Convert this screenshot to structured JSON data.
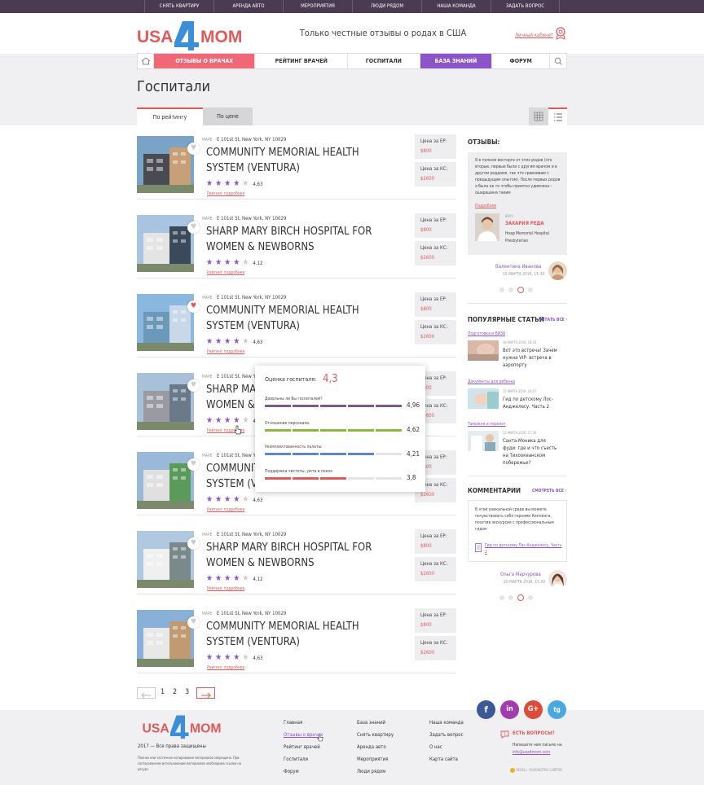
{
  "topbar": {
    "items": [
      "СНЯТЬ КВАРТИРУ",
      "АРЕНДА АВТО",
      "МЕРОПРИЯТИЯ",
      "ЛЮДИ РЯДОМ",
      "НАША КОМАНДА",
      "ЗАДАТЬ ВОПРОС"
    ]
  },
  "header": {
    "logo_left": "USA",
    "logo_mid": "4",
    "logo_right": "MOM",
    "tagline": "Только честные отзывы о родах в США",
    "cabinet": "Личный кабинет"
  },
  "nav": {
    "items": [
      "ОТЗЫВЫ О ВРАЧАХ",
      "РЕЙТИНГ ВРАЧЕЙ",
      "ГОСПИТАЛИ",
      "БАЗА ЗНАНИЙ",
      "ФОРУМ"
    ]
  },
  "page": {
    "title": "Госпитали",
    "tabs": [
      "По рейтингу",
      "По цене"
    ]
  },
  "colors": {
    "accent_red": "#e05a5a",
    "accent_purple": "#8b54c8",
    "topbar": "#4a3a52",
    "criterion_1": "#7d5a8c",
    "criterion_2": "#8ab83c",
    "criterion_3": "#5a8ac8",
    "criterion_4": "#e05a5a"
  },
  "hospitals": [
    {
      "map": "МАРЕ",
      "addr": "E 101st St, New York, NY 10029",
      "name": "COMMUNITY MEMORIAL HEALTH SYSTEM (VENTURA)",
      "rating": "4,63",
      "stars": 4,
      "more": "Рейтинг подробнее",
      "ep_label": "Цена за ЕР:",
      "ep": "$800",
      "ks_label": "Цена за КС:",
      "ks": "$2600",
      "fav": false
    },
    {
      "map": "МАРЕ",
      "addr": "E 101st St, New York, NY 10029",
      "name": "SHARP MARY BIRCH HOSPITAL FOR WOMEN & NEWBORNS",
      "rating": "4.12",
      "stars": 4,
      "more": "Рейтинг подробнее",
      "ep_label": "Цена за ЕР:",
      "ep": "$800",
      "ks_label": "Цена за КС:",
      "ks": "$2600",
      "fav": false
    },
    {
      "map": "МАРЕ",
      "addr": "E 101st St, New York, NY 10029",
      "name": "COMMUNITY MEMORIAL HEALTH SYSTEM (VENTURA)",
      "rating": "4,63",
      "stars": 4,
      "more": "Рейтинг подробнее",
      "ep_label": "Цена за ЕР:",
      "ep": "$800",
      "ks_label": "Цена за КС:",
      "ks": "$2600",
      "fav": true
    },
    {
      "map": "МАРЕ",
      "addr": "E 101st St, New York, NY 10029",
      "name": "SHARP MARY BIRCH HOSPITAL FOR WOMEN & NEWBORNS",
      "rating": "4.12",
      "stars": 4,
      "more": "Рейтинг подробнее",
      "ep_label": "Цена за ЕР:",
      "ep": "$800",
      "ks_label": "Цена за КС:",
      "ks": "$2600",
      "fav": false
    },
    {
      "map": "МАРЕ",
      "addr": "E 101st St, New York, NY 10029",
      "name": "COMMUNITY MEMORIAL HEALTH SYSTEM (VENTURA)",
      "rating": "4,63",
      "stars": 4,
      "more": "Рейтинг подробнее",
      "ep_label": "Цена за ЕР:",
      "ep": "$800",
      "ks_label": "Цена за КС:",
      "ks": "$2600",
      "fav": false
    },
    {
      "map": "МАРЕ",
      "addr": "E 101st St, New York, NY 10029",
      "name": "SHARP MARY BIRCH HOSPITAL FOR WOMEN & NEWBORNS",
      "rating": "4.12",
      "stars": 4,
      "more": "Рейтинг подробнее",
      "ep_label": "Цена за ЕР:",
      "ep": "$800",
      "ks_label": "Цена за КС:",
      "ks": "$2600",
      "fav": false
    },
    {
      "map": "МАРЕ",
      "addr": "E 101st St, New York, NY 10029",
      "name": "COMMUNITY MEMORIAL HEALTH SYSTEM (VENTURA)",
      "rating": "4,63",
      "stars": 4,
      "more": "Рейтинг подробнее",
      "ep_label": "Цена за ЕР:",
      "ep": "$800",
      "ks_label": "Цена за КС:",
      "ks": "$2600",
      "fav": false
    }
  ],
  "popup": {
    "label": "Оценка госпиталя:",
    "value": "4,3",
    "criteria": [
      {
        "label": "Довольны ли Вы госпиталем?",
        "value": "4,96",
        "fill": 0.99
      },
      {
        "label": "Отношение персонала:",
        "value": "4,62",
        "fill": 0.92
      },
      {
        "label": "Укомплектованность палаты:",
        "value": "4,21",
        "fill": 0.84
      },
      {
        "label": "Поддержка чистоты, уюта и покоя",
        "value": "3,8",
        "fill": 0.62
      }
    ]
  },
  "sidebar": {
    "reviews_title": "ОТЗЫВЫ:",
    "review_text": "Я в полном восторге от этих родов (это вторые, первые были с другим врачом и в другом роддоме, так что сравниваю с предыдущим опытом). После первых родов я была не то чтобы приятно удивлена - ошарашена таким",
    "review_more": "Подробнее",
    "doctor_role": "ВРАЧ",
    "doctor_name": "ЗАХАРИЯ РЕДА",
    "doctor_hospital": "Hoag Memorial Hospital Presbyterian",
    "review_author": "Валентина Иванова",
    "review_date": "15 МАРТА 2016, 15:30",
    "articles_title": "ПОПУЛЯРНЫЕ СТАТЬИ",
    "articles_link": "ЧИТАТЬ ВСЕ",
    "articles": [
      {
        "cat": "Подготовка и ВИЗА",
        "date": "18 МАРТА 2016, 18:30",
        "title": "Вот это встреча! Зачем нужна VIP- встреча в аэропорту"
      },
      {
        "cat": "Документы для ребенка",
        "date": "15 МАРТА 2016, 14:47",
        "title": "Гид по детскому Лос-Анджелесу. Часть 2"
      },
      {
        "cat": "Таможня и перелет",
        "date": "11 МАРТА 2016, 17:30",
        "title": "Санта-Моника для фуди: где и что съесть на Тихоокеанском побережье?"
      }
    ],
    "comments_title": "КОММЕНТАРИИ",
    "comments_link": "СМОТРЕТЬ ВСЕ",
    "comment_text": "В этой уникальной среде вы можете почувствовать себя героями Киплинга, посетив экскурсия с профессиональным гидом",
    "comment_link": "Гид по детскому Лос-Анджелесу, Часть 2",
    "comment_author": "Ольга Марчурова",
    "comment_date": "20 МАРТА 2016, 15:00"
  },
  "pagination": {
    "pages": [
      "1",
      "2",
      "3"
    ],
    "current": "3",
    "prev": "←",
    "next": "→"
  },
  "footer": {
    "copyright": "2017 — Все права защищены",
    "note": "Полное или частичное копирование материалов запрещено. При согласованном использовании материалов необходима ссылка на ресурс.",
    "col1": [
      "Главная",
      "Отзывы о врачах",
      "Рейтинг врачей",
      "Госпитали",
      "Форум"
    ],
    "col2": [
      "База знаний",
      "Снять квартиру",
      "Аренда авто",
      "Мероприятия",
      "Люди рядом"
    ],
    "col3": [
      "Наша команда",
      "Задать вопрос",
      "О нас",
      "Карта сайта"
    ],
    "question": "ЕСТЬ ВОПРОСЫ?",
    "mail_text": "Напишите нам письмо на",
    "email": "info@usa4mom.com",
    "developer": "ПЕНЕЦ - РАЗРАБОТКА САЙТОВ",
    "social": [
      "f",
      "in",
      "G+",
      "tg"
    ]
  }
}
